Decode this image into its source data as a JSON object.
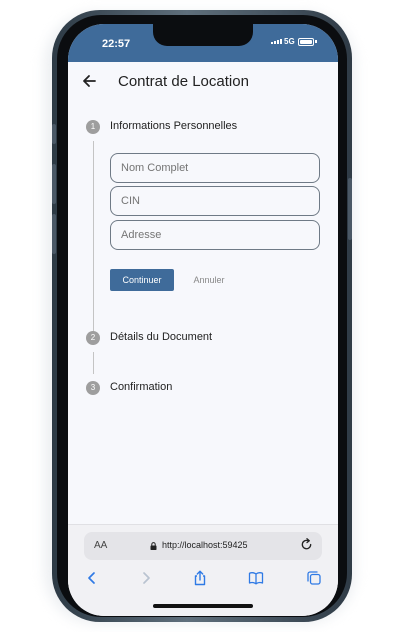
{
  "status_bar": {
    "time": "22:57",
    "network": "5G"
  },
  "header": {
    "title": "Contrat de Location"
  },
  "stepper": {
    "steps": [
      {
        "number": "1",
        "label": "Informations Personnelles"
      },
      {
        "number": "2",
        "label": "Détails du Document"
      },
      {
        "number": "3",
        "label": "Confirmation"
      }
    ],
    "fields": [
      {
        "placeholder": "Nom Complet"
      },
      {
        "placeholder": "CIN"
      },
      {
        "placeholder": "Adresse"
      }
    ],
    "continue_label": "Continuer",
    "cancel_label": "Annuler"
  },
  "browser": {
    "text_size_label": "AA",
    "url": "http://localhost:59425"
  },
  "colors": {
    "accent": "#3f6b9a",
    "step_inactive": "#9e9e9e"
  }
}
